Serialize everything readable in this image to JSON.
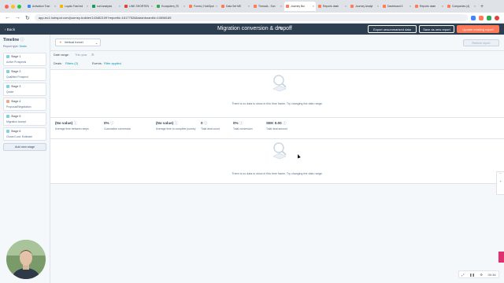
{
  "browser": {
    "tabs": [
      {
        "label": "Activation Tran",
        "color": "#4285f4"
      },
      {
        "label": "Loyalo Fast Ind",
        "color": "#f4b400"
      },
      {
        "label": "surf-analysis",
        "color": "#0f9d58"
      },
      {
        "label": "LINK SHORTEN",
        "color": "#db4437"
      },
      {
        "label": "Ecosystem_RI",
        "color": "#34a853"
      },
      {
        "label": "Forms | HubSpot",
        "color": "#ff7a59"
      },
      {
        "label": "Data Set ME",
        "color": "#ff7a59"
      },
      {
        "label": "Threads - Sun",
        "color": "#ff7a59"
      },
      {
        "label": "Journey Bui",
        "color": "#ff7a59",
        "active": true
      },
      {
        "label": "Reports dash",
        "color": "#ff7a59"
      },
      {
        "label": "Journey Analyt",
        "color": "#ff7a59"
      },
      {
        "label": "Dashboard 3",
        "color": "#ff7a59"
      },
      {
        "label": "Reports dash",
        "color": "#ff7a59"
      },
      {
        "label": "Companies (4)",
        "color": "#ff7a59"
      }
    ],
    "url": "app-eu1.hubspot.com/journey-builder/143482109?reportId=16177528&dashboardId=10858185",
    "new_tab": "+"
  },
  "header": {
    "back_label": "‹ Back",
    "title": "Migration conversion & dropoff",
    "edit_icon": "pencil-icon",
    "btn_export": "Export unsummarized data",
    "btn_save_new": "Save as new report",
    "btn_update": "Update existing report"
  },
  "sidebar": {
    "title": "Timeline",
    "report_type_label": "Report type:",
    "report_type_value": "Deals",
    "stages": [
      {
        "name": "Stage 1",
        "detail": "Active Prospects",
        "color": "#7fd1de"
      },
      {
        "name": "Stage 2",
        "detail": "Qualified Prospect",
        "color": "#7fd1de"
      },
      {
        "name": "Stage 3",
        "detail": "Quote",
        "color": "#7fd1de"
      },
      {
        "name": "Stage 4",
        "detail": "Proposal/Negotiation",
        "color": "#f2a78b"
      },
      {
        "name": "Stage 5",
        "detail": "Migration Accept",
        "color": "#7fd1de"
      },
      {
        "name": "Stage 6",
        "detail": "Closed Lost: Estimate",
        "color": "#7fd1de"
      }
    ],
    "add_stage_label": "Add new stage"
  },
  "main": {
    "funnel_label": "Vertical funnel",
    "refresh_label": "Refresh report",
    "date_range_label": "Date range:",
    "date_range_value": "This year",
    "deals_label": "Deals:",
    "deals_filter": "Filters (2)",
    "events_label": "Events:",
    "events_filter": "Filter applied",
    "empty_message": "There is no data to show in this time frame. Try changing the date range.",
    "stats": [
      {
        "value": "(No value)",
        "label": "Average time between steps"
      },
      {
        "value": "0%",
        "label": "Cumulative conversion"
      },
      {
        "value": "(No value)",
        "label": "Average time to complete journey"
      },
      {
        "value": "0",
        "label": "Total deal count"
      },
      {
        "value": "0%",
        "label": "Total conversion"
      },
      {
        "value": "SEK 0.00",
        "label": "Total deal amount"
      }
    ]
  },
  "widgets": {
    "zoom": "00:36"
  }
}
